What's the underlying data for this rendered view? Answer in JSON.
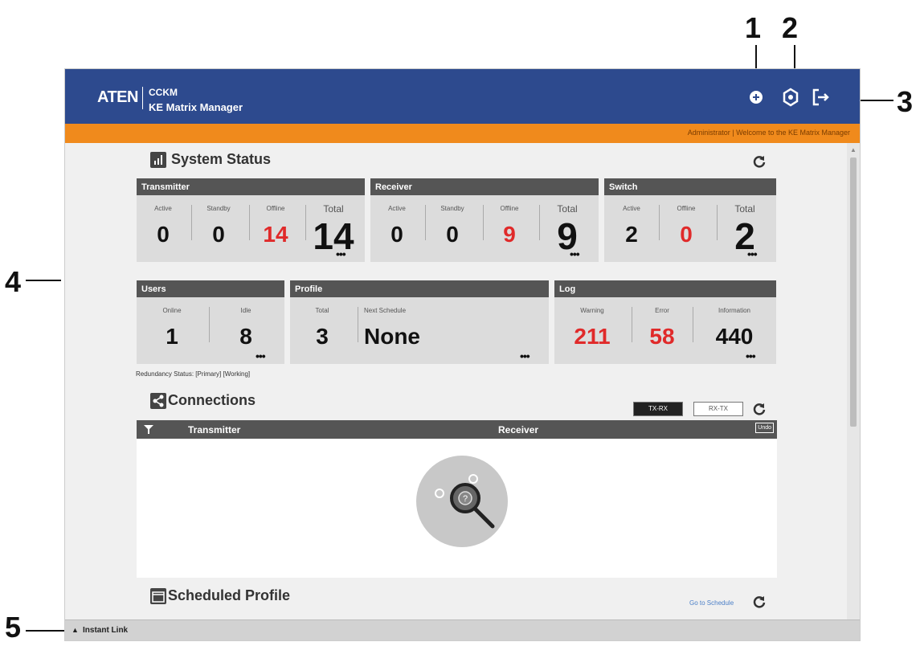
{
  "callouts": {
    "c1": "1",
    "c2": "2",
    "c3": "3",
    "c4": "4",
    "c5": "5"
  },
  "header": {
    "logo": "ATEN",
    "product": "CCKM",
    "app_name": "KE Matrix Manager",
    "welcome": "Administrator | Welcome to the KE Matrix Manager"
  },
  "system_status": {
    "title": "System Status",
    "transmitter": {
      "title": "Transmitter",
      "active_label": "Active",
      "active": "0",
      "standby_label": "Standby",
      "standby": "0",
      "offline_label": "Offline",
      "offline": "14",
      "total_label": "Total",
      "total": "14"
    },
    "receiver": {
      "title": "Receiver",
      "active_label": "Active",
      "active": "0",
      "standby_label": "Standby",
      "standby": "0",
      "offline_label": "Offline",
      "offline": "9",
      "total_label": "Total",
      "total": "9"
    },
    "switch": {
      "title": "Switch",
      "active_label": "Active",
      "active": "2",
      "offline_label": "Offline",
      "offline": "0",
      "total_label": "Total",
      "total": "2"
    },
    "users": {
      "title": "Users",
      "online_label": "Online",
      "online": "1",
      "idle_label": "Idle",
      "idle": "8"
    },
    "profile": {
      "title": "Profile",
      "total_label": "Total",
      "total": "3",
      "next_label": "Next Schedule",
      "next": "None"
    },
    "log": {
      "title": "Log",
      "warning_label": "Warning",
      "warning": "211",
      "error_label": "Error",
      "error": "58",
      "info_label": "Information",
      "info": "440"
    },
    "more": "•••",
    "redundancy": "Redundancy Status: [Primary] [Working]"
  },
  "connections": {
    "title": "Connections",
    "btn_txrx": "TX-RX",
    "btn_rxtx": "RX-TX",
    "col_tx": "Transmitter",
    "col_rx": "Receiver",
    "undo": "Undo"
  },
  "scheduled": {
    "title": "Scheduled Profile",
    "go": "Go to Schedule"
  },
  "footer": {
    "instant_link": "Instant Link"
  },
  "colors": {
    "header": "#2d4a8e",
    "accent": "#f08a1c",
    "alert": "#e02a2a"
  }
}
